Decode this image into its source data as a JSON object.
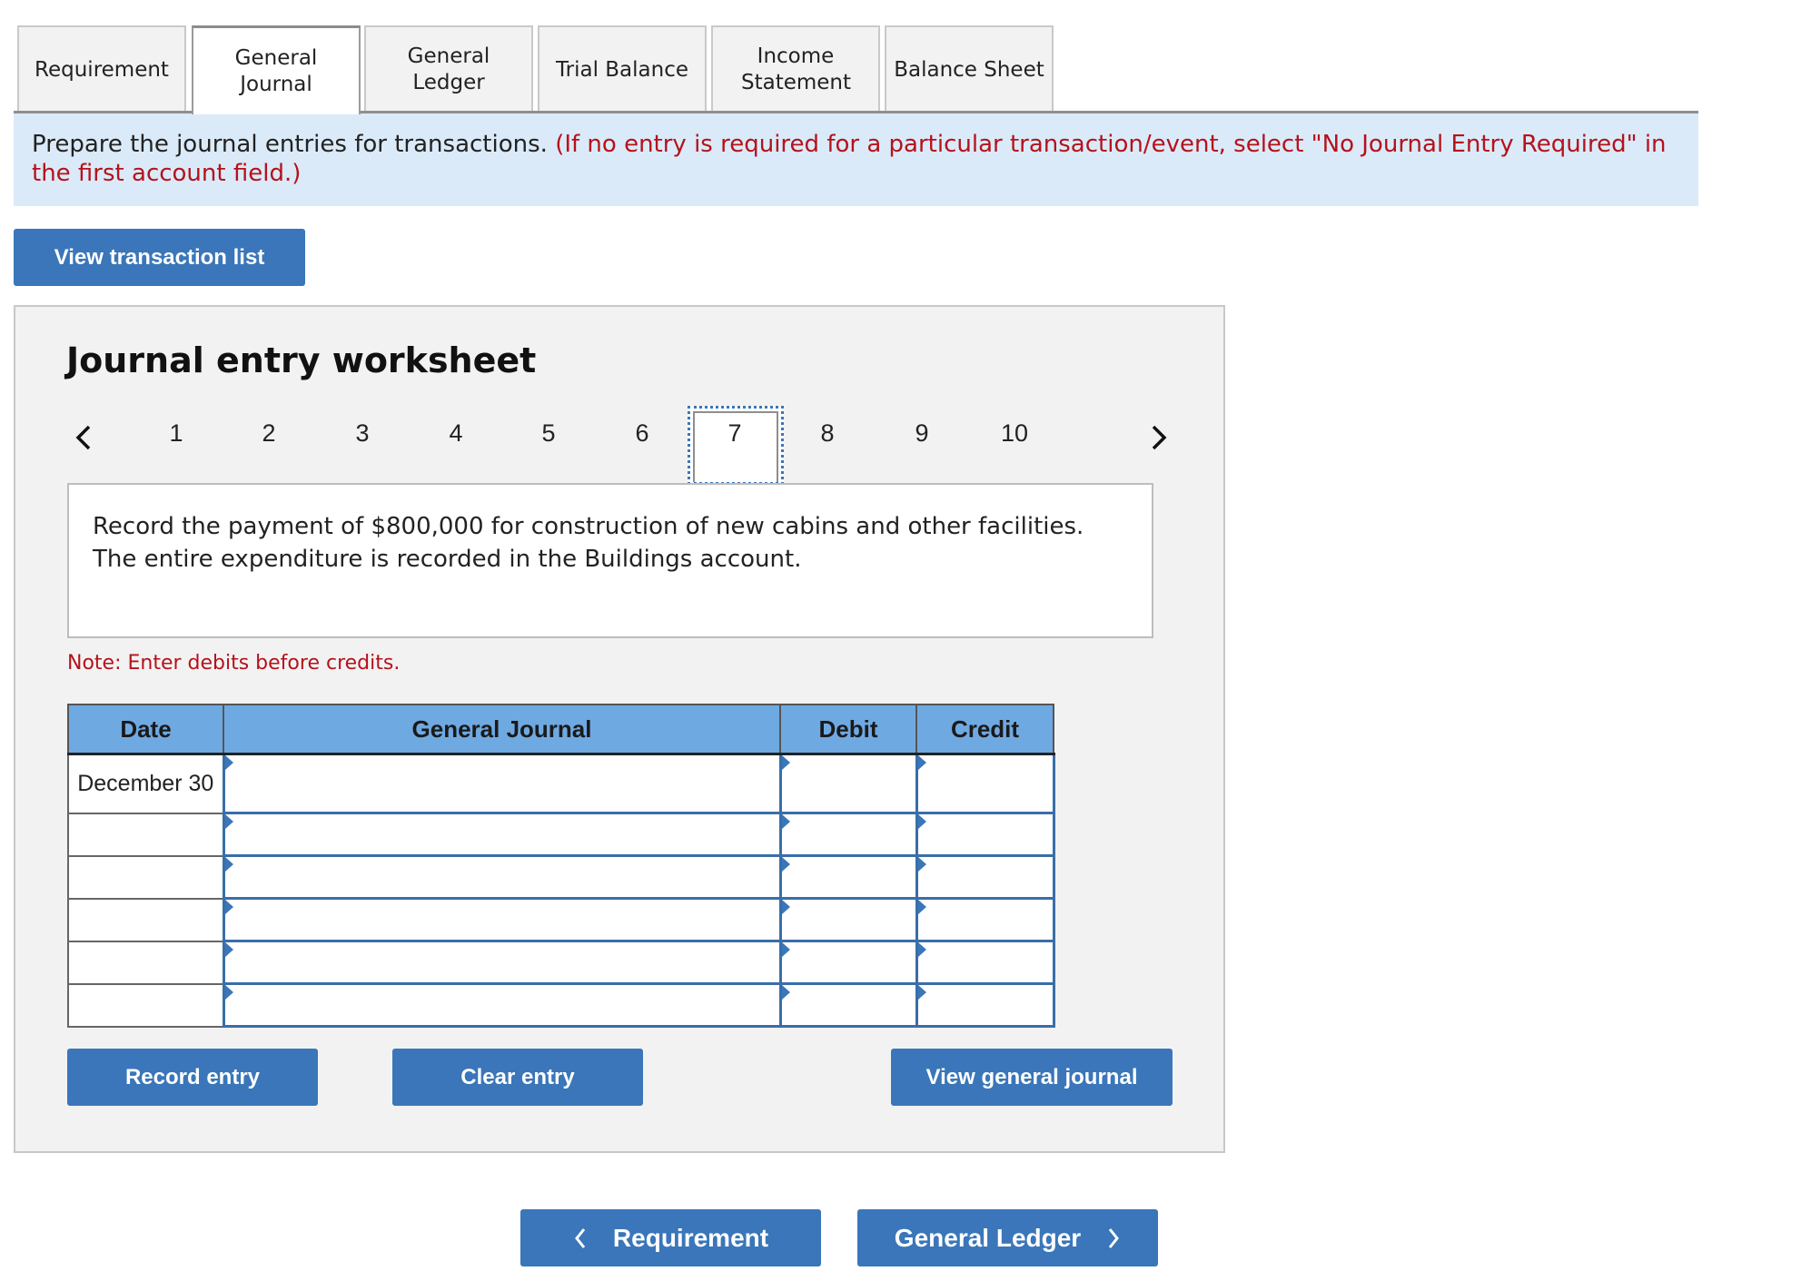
{
  "tabs": [
    {
      "label": "Requirement",
      "active": false
    },
    {
      "label": "General Journal",
      "active": true
    },
    {
      "label": "General Ledger",
      "active": false
    },
    {
      "label": "Trial Balance",
      "active": false
    },
    {
      "label": "Income Statement",
      "active": false
    },
    {
      "label": "Balance Sheet",
      "active": false
    }
  ],
  "instructions": {
    "main": "Prepare the journal entries for transactions.",
    "note": "(If no entry is required for a particular transaction/event, select \"No Journal Entry Required\" in the first account field.)"
  },
  "view_transaction_list_label": "View transaction list",
  "worksheet": {
    "title": "Journal entry worksheet",
    "pager": {
      "prev_icon": "chevron-left-icon",
      "next_icon": "chevron-right-icon",
      "pages": [
        "1",
        "2",
        "3",
        "4",
        "5",
        "6",
        "7",
        "8",
        "9",
        "10"
      ],
      "active_page": "7"
    },
    "description": "Record the payment of $800,000 for construction of new cabins and other facilities. The entire expenditure is recorded in the Buildings account.",
    "note": "Note: Enter debits before credits.",
    "table": {
      "headers": {
        "date": "Date",
        "general_journal": "General Journal",
        "debit": "Debit",
        "credit": "Credit"
      },
      "rows": [
        {
          "date": "December 30",
          "account": "",
          "debit": "",
          "credit": ""
        },
        {
          "date": "",
          "account": "",
          "debit": "",
          "credit": ""
        },
        {
          "date": "",
          "account": "",
          "debit": "",
          "credit": ""
        },
        {
          "date": "",
          "account": "",
          "debit": "",
          "credit": ""
        },
        {
          "date": "",
          "account": "",
          "debit": "",
          "credit": ""
        },
        {
          "date": "",
          "account": "",
          "debit": "",
          "credit": ""
        }
      ]
    },
    "buttons": {
      "record": "Record entry",
      "clear": "Clear entry",
      "view_general_journal": "View general journal"
    }
  },
  "bottom_nav": {
    "prev_label": "Requirement",
    "next_label": "General Ledger"
  },
  "colors": {
    "accent_blue": "#3a76b9",
    "header_blue": "#6fa9e2",
    "instruction_bg": "#dbeaf8",
    "warning_red": "#b5121b"
  }
}
